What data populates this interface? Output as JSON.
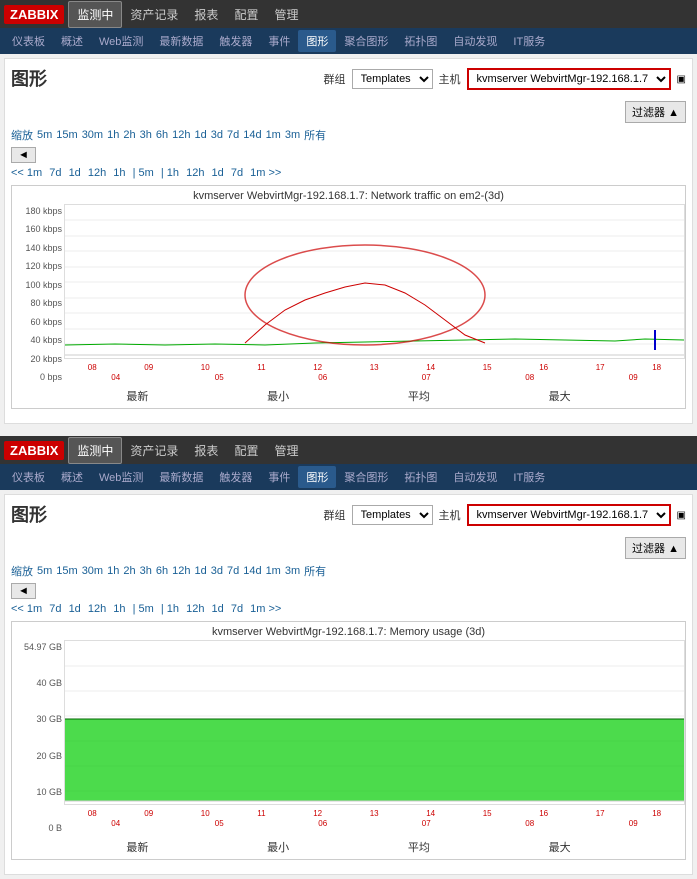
{
  "app": {
    "logo": "ZABBIX",
    "nav": {
      "items": [
        {
          "label": "监测中",
          "active": true
        },
        {
          "label": "资产记录",
          "active": false
        },
        {
          "label": "报表",
          "active": false
        },
        {
          "label": "配置",
          "active": false
        },
        {
          "label": "管理",
          "active": false
        }
      ]
    },
    "subnav": {
      "items": [
        {
          "label": "仪表板",
          "active": false
        },
        {
          "label": "概述",
          "active": false
        },
        {
          "label": "Web监测",
          "active": false
        },
        {
          "label": "最新数据",
          "active": false
        },
        {
          "label": "触发器",
          "active": false
        },
        {
          "label": "事件",
          "active": false
        },
        {
          "label": "图形",
          "active": true
        },
        {
          "label": "聚合图形",
          "active": false
        },
        {
          "label": "拓扑图",
          "active": false
        },
        {
          "label": "自动发现",
          "active": false
        },
        {
          "label": "IT服务",
          "active": false
        }
      ]
    }
  },
  "panel1": {
    "title": "图形",
    "filter": {
      "group_label": "群组",
      "group_value": "Templates",
      "host_label": "主机",
      "host_value": "kvmserver WebvirtMgr-192.168.1.7",
      "filter_button": "过滤器 ▲"
    },
    "zoom_options": [
      "缩放",
      "5m",
      "15m",
      "30m",
      "1h",
      "2h",
      "3h",
      "6h",
      "12h",
      "1d",
      "3d",
      "7d",
      "14d",
      "1m",
      "3m",
      "所有"
    ],
    "time_nav": "<< 1m | 7d | 1d | 12h | 1h | 5m | 1h | 12h | 1d | 7d | 1m >>",
    "chart1": {
      "title": "kvmserver WebvirtMgr-192.168.1.7: Network traffic on em2-(3d)",
      "y_labels": [
        "180 kbps",
        "160 kbps",
        "140 kbps",
        "120 kbps",
        "100 kbps",
        "80 kbps",
        "60 kbps",
        "40 kbps",
        "20 kbps",
        "0 bps"
      ],
      "footer": {
        "last": "最新",
        "min": "最小",
        "avg": "平均",
        "max": "最大"
      }
    }
  },
  "panel2": {
    "title": "图形",
    "filter": {
      "group_label": "群组",
      "group_value": "Templates",
      "host_label": "主机",
      "host_value": "kvmserver WebvirtMgr-192.168.1.7",
      "filter_button": "过滤器 ▲"
    },
    "zoom_options": [
      "缩放",
      "5m",
      "15m",
      "30m",
      "1h",
      "2h",
      "3h",
      "6h",
      "12h",
      "1d",
      "3d",
      "7d",
      "14d",
      "1m",
      "3m",
      "所有"
    ],
    "time_nav": "<< 1m | 7d | 1d | 12h | 1h | 5m | 1h | 12h | 1d | 7d | 1m >>",
    "chart2": {
      "title": "kvmserver WebvirtMgr-192.168.1.7: Memory usage (3d)",
      "y_labels": [
        "54.97 GB",
        "40 GB",
        "30 GB",
        "20 GB",
        "10 GB",
        "0 B"
      ],
      "footer": {
        "last": "最新",
        "min": "最小",
        "avg": "平均",
        "max": "最大"
      }
    }
  }
}
